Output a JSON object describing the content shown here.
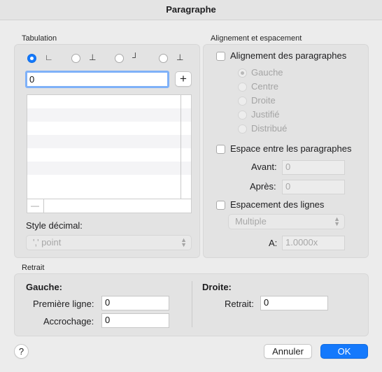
{
  "window": {
    "title": "Paragraphe"
  },
  "tabulation": {
    "section_label": "Tabulation",
    "type_glyphs": [
      "∟",
      "⊥",
      "┘",
      "⊥"
    ],
    "position_value": "0",
    "add_label": "+",
    "remove_label": "—",
    "decimal_style_label": "Style décimal:",
    "decimal_style_value": "',' point"
  },
  "alignment": {
    "section_label": "Alignement et espacement",
    "paragraph_alignment_label": "Alignement des paragraphes",
    "options": [
      "Gauche",
      "Centre",
      "Droite",
      "Justifié",
      "Distribué"
    ],
    "paragraph_spacing_label": "Espace entre les paragraphes",
    "before_label": "Avant:",
    "before_value": "0",
    "after_label": "Après:",
    "after_value": "0",
    "line_spacing_label": "Espacement des lignes",
    "line_spacing_value": "Multiple",
    "at_label": "A:",
    "at_value": "1.0000x"
  },
  "indent": {
    "section_label": "Retrait",
    "left_heading": "Gauche:",
    "first_line_label": "Première ligne:",
    "first_line_value": "0",
    "hanging_label": "Accrochage:",
    "hanging_value": "0",
    "right_heading": "Droite:",
    "right_label": "Retrait:",
    "right_value": "0"
  },
  "footer": {
    "help_label": "?",
    "cancel_label": "Annuler",
    "ok_label": "OK"
  },
  "colors": {
    "accent": "#1479fc"
  }
}
